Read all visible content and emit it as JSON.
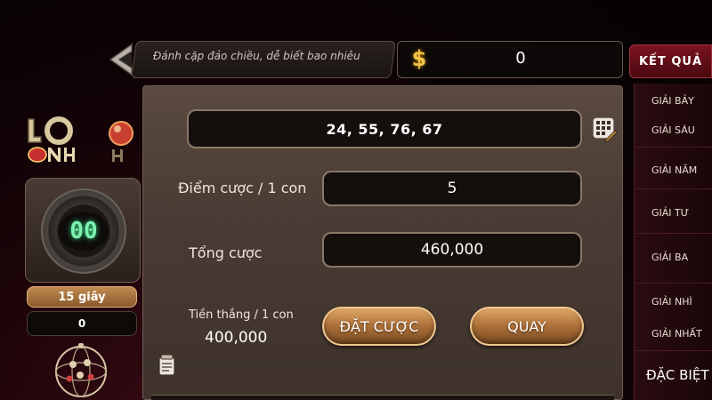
{
  "header": {
    "title": "Đánh cặp đảo chiều, dễ biết bao nhiêu",
    "coin_symbol": "$",
    "balance": "0"
  },
  "results": {
    "title": "KẾT QUẢ",
    "items": [
      "GIẢI BẢY",
      "GIẢI SÁU",
      "GIẢI NĂM",
      "GIẢI TƯ",
      "GIẢI BA",
      "GIẢI NHÌ",
      "GIẢI NHẤT",
      "ĐẶC BIỆT"
    ]
  },
  "betting": {
    "selected_numbers": "24, 55, 76, 67",
    "points_label": "Điểm cược / 1 con",
    "points_value": "5",
    "total_label": "Tổng cược",
    "total_value": "460,000",
    "win_label": "Tiền thắng / 1 con",
    "win_value": "400,000",
    "bet_button": "ĐẶT CƯỢC",
    "spin_button": "QUAY"
  },
  "timer": {
    "display": "00",
    "seconds_label": "15 giây",
    "count": "0"
  },
  "colors": {
    "accent_gold": "#b0743c",
    "result_red": "#7a1420",
    "timer_green": "#7df0b0",
    "coin_gold": "#f4c24a"
  },
  "icons": {
    "back": "chevron-left-icon",
    "coin": "dollar-icon",
    "keypad": "keypad-edit-icon",
    "note": "notepad-icon"
  }
}
